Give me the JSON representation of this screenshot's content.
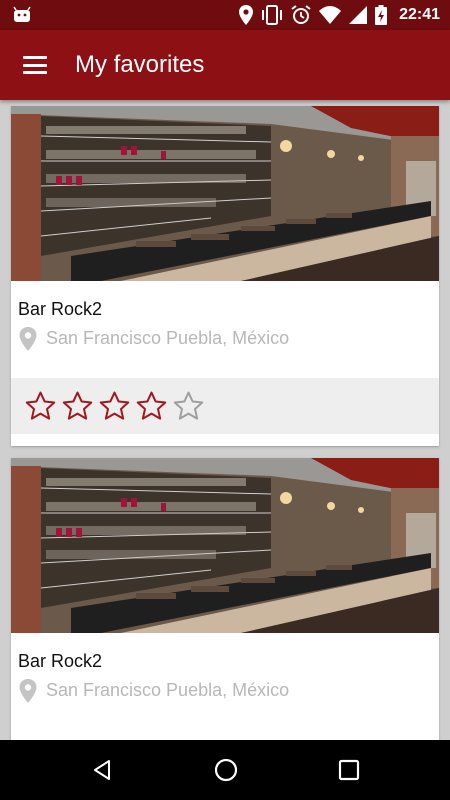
{
  "status_bar": {
    "time": "22:41",
    "icons": [
      "android-icon",
      "location-icon",
      "vibrate-icon",
      "alarm-icon",
      "wifi-icon",
      "signal-icon",
      "battery-charging-icon"
    ]
  },
  "app_bar": {
    "title": "My favorites",
    "menu_icon": "hamburger-menu-icon"
  },
  "favorites": [
    {
      "name": "Bar Rock2",
      "location": "San Francisco Puebla, México",
      "rating": 4,
      "max_rating": 5
    },
    {
      "name": "Bar Rock2",
      "location": "San Francisco Puebla, México"
    }
  ],
  "nav_bar": {
    "icons": [
      "back-icon",
      "home-icon",
      "recents-icon"
    ]
  },
  "colors": {
    "status_bar": "#6f0c10",
    "app_bar": "#8d1015",
    "star": "#a3161c",
    "star_empty": "#9e9e9e",
    "nav_bar": "#000000"
  }
}
